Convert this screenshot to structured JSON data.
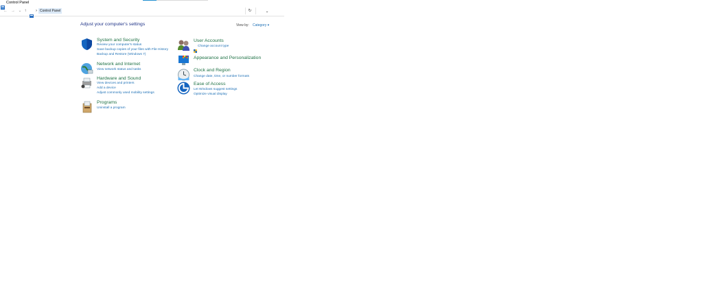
{
  "window": {
    "title": "Control Panel"
  },
  "address": {
    "crumb": "Control Panel",
    "separator": "›"
  },
  "nav": {
    "back": "←",
    "forward": "→",
    "down": "⌄",
    "up": "↑",
    "dropdown": "⌄",
    "refresh": "↻"
  },
  "main": {
    "heading": "Adjust your computer's settings",
    "view_by_label": "View by:",
    "view_by_value": "Category ▾"
  },
  "categories": [
    {
      "title": "System and Security",
      "links": [
        "Review your computer's status",
        "Save backup copies of your files with File History",
        "Backup and Restore (Windows 7)"
      ]
    },
    {
      "title": "Network and Internet",
      "links": [
        "View network status and tasks"
      ]
    },
    {
      "title": "Hardware and Sound",
      "links": [
        "View devices and printers",
        "Add a device",
        "Adjust commonly used mobility settings"
      ]
    },
    {
      "title": "Programs",
      "links": [
        "Uninstall a program"
      ]
    },
    {
      "title": "User Accounts",
      "links": [
        "Change account type"
      ]
    },
    {
      "title": "Appearance and Personalization",
      "links": []
    },
    {
      "title": "Clock and Region",
      "links": [
        "Change date, time, or number formats"
      ]
    },
    {
      "title": "Ease of Access",
      "links": [
        "Let Windows suggest settings",
        "Optimize visual display"
      ]
    }
  ],
  "icons": {
    "system": "shield-icon",
    "network": "globe-icon",
    "hardware": "printer-icon",
    "programs": "programs-icon",
    "users": "users-icon",
    "appearance": "appearance-icon",
    "clock": "clock-icon",
    "ease": "ease-of-access-icon"
  },
  "colors": {
    "heading": "#1e3287",
    "category": "#1e7145",
    "link": "#1c6fb5",
    "accent": "#1f8fd0"
  }
}
